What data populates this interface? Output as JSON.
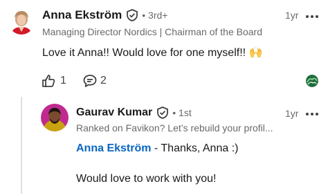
{
  "comment": {
    "author": "Anna Ekström",
    "degree": "• 3rd+",
    "headline": "Managing Director Nordics | Chairman of the Board",
    "time": "1yr",
    "text": "Love it Anna!! Would love for one myself!! ",
    "emoji": "🙌",
    "likes": "1",
    "replies": "2"
  },
  "reply": {
    "author": "Gaurav Kumar",
    "degree": "• 1st",
    "headline": "Ranked on Favikon? Let’s rebuild your profil...",
    "time": "1yr",
    "mention": "Anna Ekström",
    "text_line1": " - Thanks, Anna :)",
    "text_line2": "Would love to work with you!"
  },
  "colors": {
    "mention": "#0a66c2",
    "muted": "#666666"
  }
}
